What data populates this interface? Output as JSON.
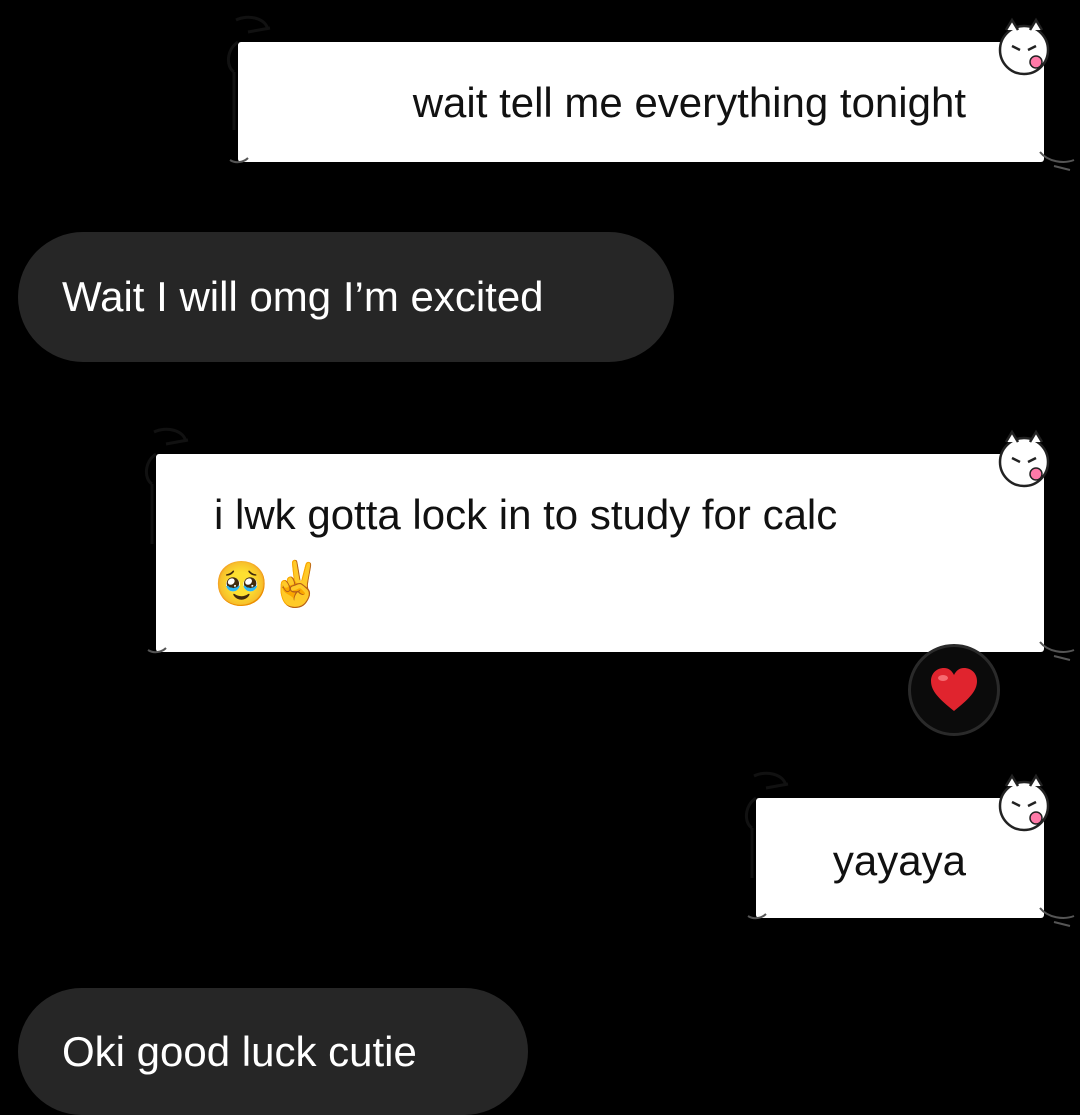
{
  "conversation": {
    "messages": [
      {
        "direction": "sent",
        "text": "wait tell me everything tonight"
      },
      {
        "direction": "received",
        "text": "Wait I will omg I’m excited"
      },
      {
        "direction": "sent",
        "text": "i lwk gotta lock in to study for calc",
        "emojis": "🥹✌️",
        "reaction": "❤️"
      },
      {
        "direction": "sent",
        "text": "yayaya"
      },
      {
        "direction": "received",
        "text": "Oki good luck cutie"
      }
    ]
  },
  "colors": {
    "background": "#000000",
    "received_bubble": "#262626",
    "sent_bubble": "#ffffff",
    "reaction_heart": "#e0242e"
  },
  "icons": {
    "bubble_theme": "scroll-cat-sticker",
    "reaction": "red-heart-icon"
  }
}
